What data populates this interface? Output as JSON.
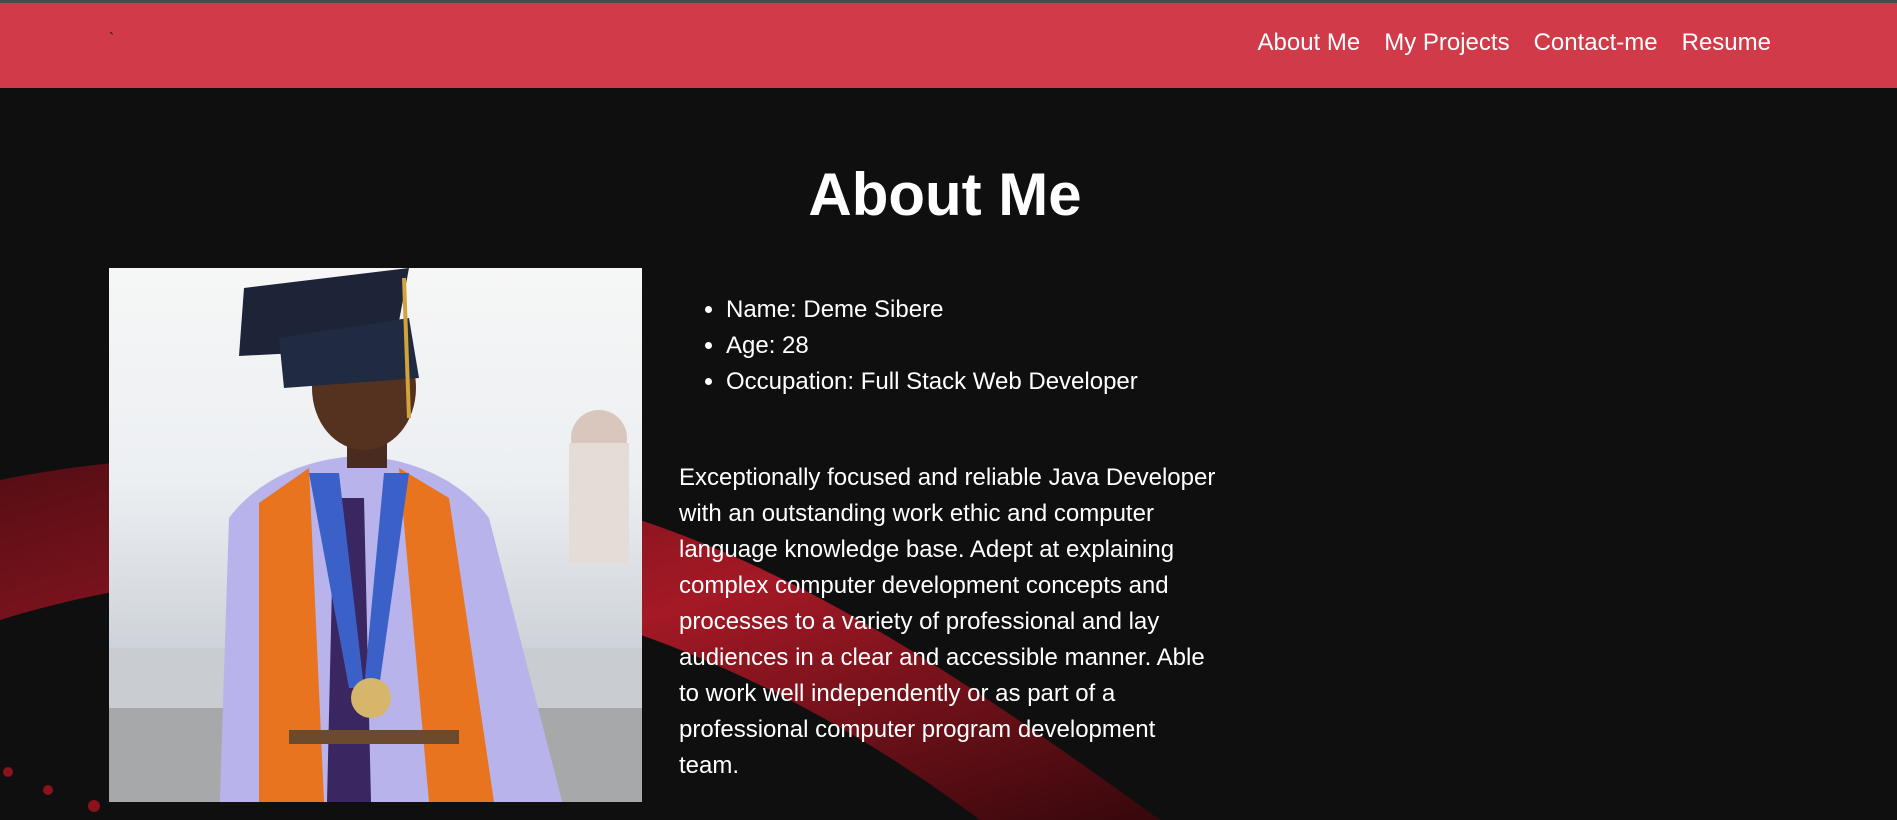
{
  "nav": {
    "brand": "`",
    "links": [
      "About Me",
      "My Projects",
      "Contact-me",
      "Resume"
    ]
  },
  "about": {
    "title": "About Me",
    "photo_alt": "graduation portrait",
    "facts": [
      "Name: Deme Sibere",
      "Age: 28",
      "Occupation: Full Stack Web Developer"
    ],
    "bio": "Exceptionally focused and reliable Java Developer with an outstanding work ethic and computer language knowledge base. Adept at explaining complex computer development concepts and processes to a variety of professional and lay audiences in a clear and accessible manner. Able to work well independently or as part of a professional computer program development team."
  },
  "colors": {
    "navbar": "#d13a48",
    "background": "#0f0f10",
    "text": "#ffffff"
  }
}
